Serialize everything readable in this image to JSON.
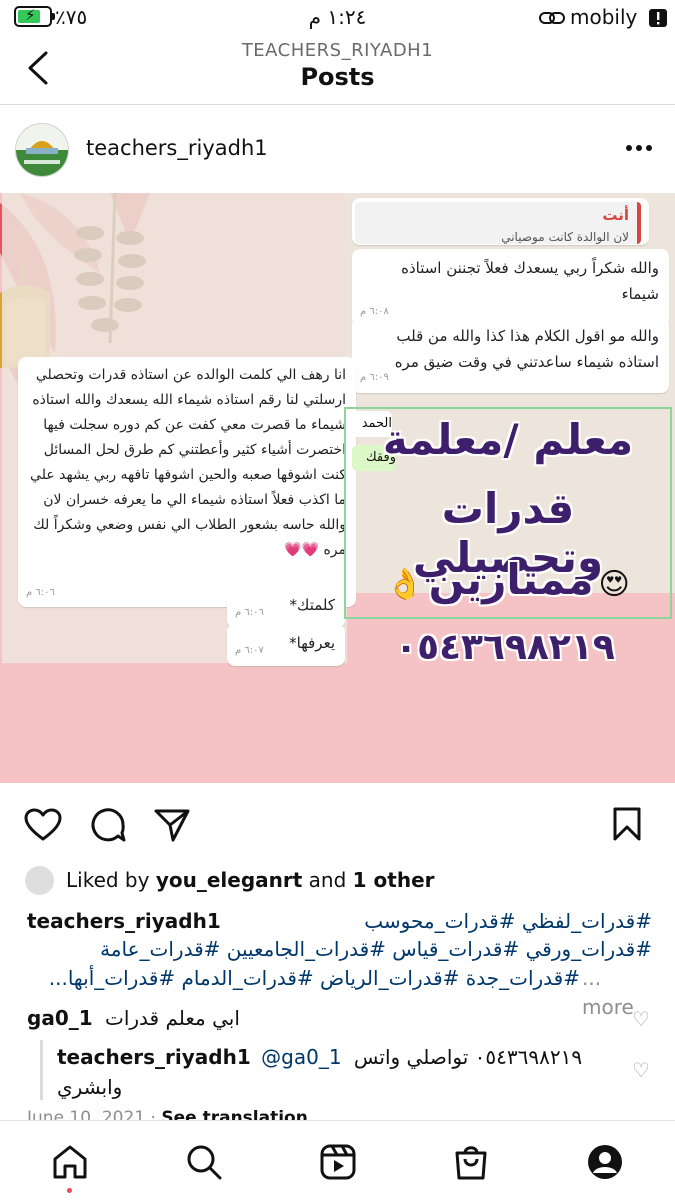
{
  "status_bar": {
    "battery_percent": "٪٧٥",
    "time": "١:٢٤ م",
    "carrier": "mobily"
  },
  "header": {
    "account_subtitle": "TEACHERS_RIYADH1",
    "title": "Posts"
  },
  "post": {
    "username": "teachers_riyadh1",
    "image": {
      "reply_label": "أنت",
      "reply_quote": "لان الوالدة كانت موصياني",
      "chat_bubbles": [
        {
          "text": "والله شكراً ربي يسعدك فعلاً تجننن استاذه شيماء",
          "time": "٦:٠٨ م"
        },
        {
          "text": "والله مو اقول الكلام هذا كذا والله من قلب استاذه شيماء ساعدتني في وقت ضيق مره",
          "time": "٦:٠٩ م"
        },
        {
          "text": "انا رهف الي كلمت الوالده عن استاذه قدرات وتحصلي ارسلتي لنا رقم استاذه شيماء الله يسعدك والله استاذه شيماء ما قصرت معي كفت عن كم دوره سجلت فيها اختصرت أشياء كثير وأعطتني كم طرق لحل المسائل كنت اشوفها صعبه والحين اشوفها تافهه ربي يشهد علي ما اكذب فعلاً استاذه شيماء الي ما يعرفه خسران لان والله حاسه بشعور الطلاب الي نفس وضعي وشكراً لك مره 💗💗",
          "time": "٦:٠٦ م"
        },
        {
          "text": "كلمتك*",
          "time": "٦:٠٦ م"
        },
        {
          "text": "يعرفها*",
          "time": "٦:٠٧ م"
        }
      ],
      "partial_bubble_1": "الحمد لله",
      "partial_bubble_2": "وفقك",
      "ad_line1": "معلم /معلمة",
      "ad_line2": "قدرات وتحصيلي",
      "ad_line3": "ممتازين",
      "ad_phone": "٠٥٤٣٦٩٨٢١٩"
    },
    "likes": {
      "prefix": "Liked by",
      "user": "you_eleganrt",
      "conj": "and",
      "others": "1 other"
    },
    "caption": {
      "username": "teachers_riyadh1",
      "line1": "#قدرات_لفظي #قدرات_محوسب",
      "line2": "#قدرات_ورقي #قدرات_قياس #قدرات_الجامعيين #قدرات_عامة",
      "line3": "#قدرات_جدة #قدرات_الرياض #قدرات_الدمام #قدرات_أبها...",
      "more": "... more"
    },
    "comments": [
      {
        "username": "ga0_1",
        "text": "ابي معلم قدرات"
      },
      {
        "username": "teachers_riyadh1",
        "mention": "@ga0_1",
        "text": "٠٥٤٣٦٩٨٢١٩ تواصلي واتس",
        "text2": "وابشري"
      }
    ],
    "footer": {
      "date": "June 10, 2021",
      "separator": "·",
      "translation": "See translation"
    }
  },
  "bottom_nav": [
    "home",
    "search",
    "reels",
    "shop",
    "profile"
  ],
  "colors": {
    "accent_link": "#00376b",
    "image_bg": "#f5c3c5",
    "ad_purple": "#3d1f6b"
  }
}
